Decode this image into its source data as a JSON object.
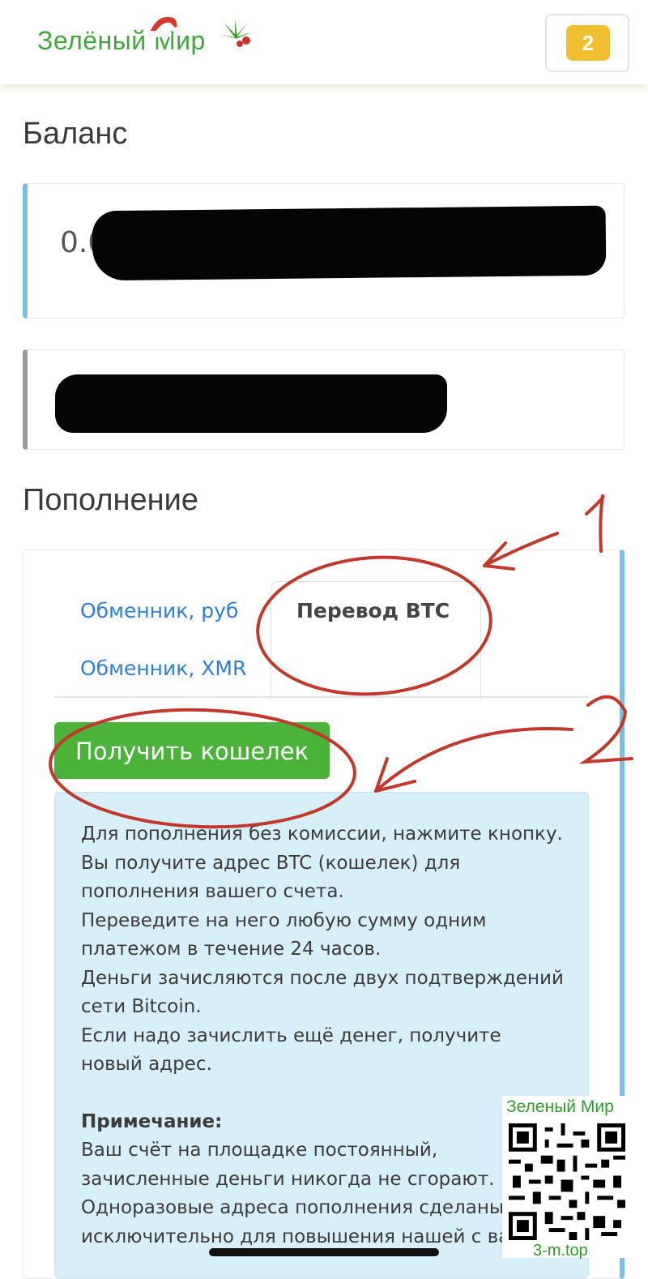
{
  "header": {
    "logo_text": "Зелёный Мир",
    "cart_count": "2"
  },
  "balance": {
    "title": "Баланс",
    "value_visible": "0.0"
  },
  "topup": {
    "title": "Пополнение",
    "tabs": [
      {
        "label": "Обменник, руб",
        "active": false
      },
      {
        "label": "Перевод BTC",
        "active": true
      },
      {
        "label": "Обменник, XMR",
        "active": false
      }
    ],
    "get_wallet_button": "Получить кошелек",
    "info_lines": [
      "Для пополнения без комиссии, нажмите кнопку.",
      "Вы получите адрес BTC (кошелек) для пополнения вашего счета.",
      "Переведите на него любую сумму одним платежом в течение 24 часов.",
      "Деньги зачисляются после двух подтверждений сети Bitcoin.",
      "Если надо зачислить ещё денег, получите новый адрес."
    ],
    "note_title": "Примечание:",
    "note_lines": [
      "Ваш счёт на площадке постоянный, зачисленные деньги никогда не сгорают.",
      "Одноразовые адреса пополнения сделаны исключительно для повышения нашей с вами"
    ]
  },
  "annotations": {
    "label_1": "1",
    "label_2": "2",
    "color": "#c0392b"
  },
  "watermark": {
    "title": "Зеленый Мир",
    "url": "3-m.top"
  },
  "colors": {
    "accent_blue": "#79bfe0",
    "button_green": "#4cb33a",
    "badge_yellow": "#f0c030",
    "link_blue": "#2f7fd6"
  }
}
